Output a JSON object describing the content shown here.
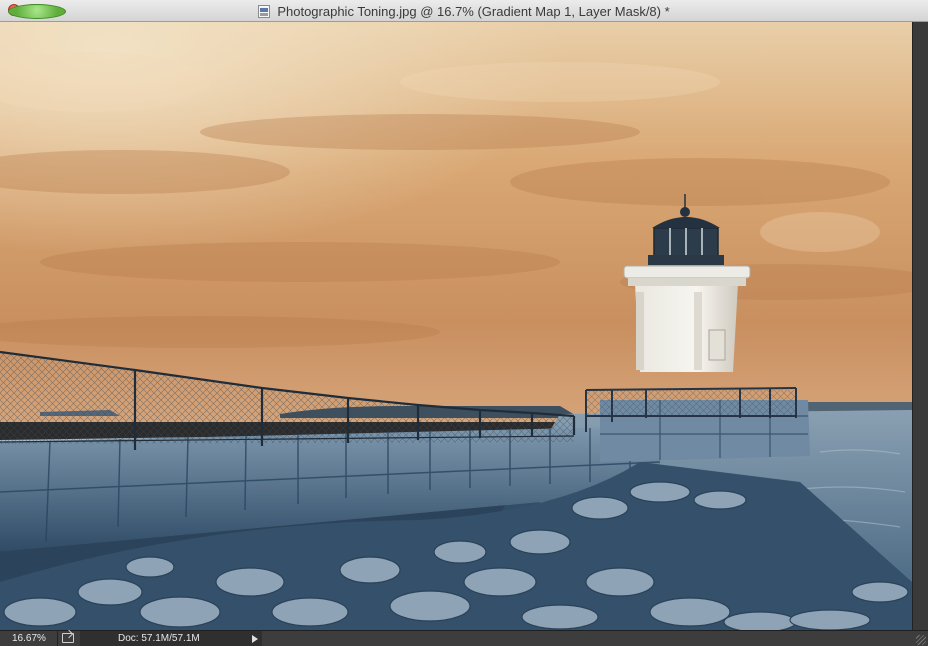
{
  "window": {
    "title": "Photographic Toning.jpg @ 16.7% (Gradient Map 1, Layer Mask/8) *",
    "file_icon": "document-icon"
  },
  "photo": {
    "subject": "lighthouse-on-breakwater",
    "toning": "split-tone-sepia-and-blue"
  },
  "statusbar": {
    "zoom": "16.67%",
    "doc_info": "Doc: 57.1M/57.1M",
    "share_icon": "share-icon",
    "menu_arrow_icon": "play-arrow-icon"
  },
  "colors": {
    "sky_warm": "#d7a46f",
    "sea_cool": "#4e6f8c",
    "chrome_dark": "#3d3d3d"
  }
}
